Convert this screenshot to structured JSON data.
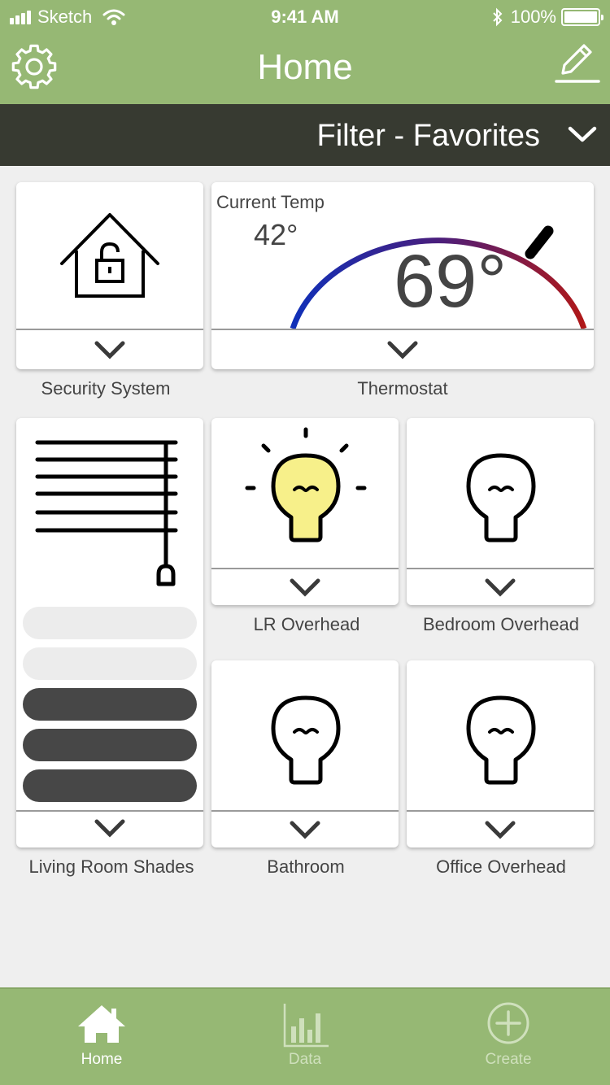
{
  "status_bar": {
    "carrier": "Sketch",
    "time": "9:41 AM",
    "battery": "100%"
  },
  "nav": {
    "title": "Home"
  },
  "filter": {
    "label": "Filter - Favorites"
  },
  "tiles": {
    "security": {
      "name": "Security System"
    },
    "thermostat": {
      "name": "Thermostat",
      "current_label": "Current Temp",
      "current_value": "42°",
      "set_value": "69°"
    },
    "lr_overhead": {
      "name": "LR Overhead",
      "state": "on"
    },
    "bedroom_overhead": {
      "name": "Bedroom Overhead",
      "state": "off"
    },
    "shades": {
      "name": "Living Room Shades",
      "levels_closed": 3,
      "levels_total": 5
    },
    "bathroom": {
      "name": "Bathroom",
      "state": "off"
    },
    "office_overhead": {
      "name": "Office Overhead",
      "state": "off"
    }
  },
  "tabbar": {
    "tabs": [
      {
        "label": "Home",
        "icon": "home-icon",
        "active": true
      },
      {
        "label": "Data",
        "icon": "bar-chart-icon",
        "active": false
      },
      {
        "label": "Create",
        "icon": "plus-circle-icon",
        "active": false
      }
    ]
  },
  "colors": {
    "brand_green": "#96b874",
    "filter_bar": "#373a31",
    "bulb_on": "#f7f08a",
    "gauge_start": "#1030b8",
    "gauge_end": "#b01818"
  }
}
